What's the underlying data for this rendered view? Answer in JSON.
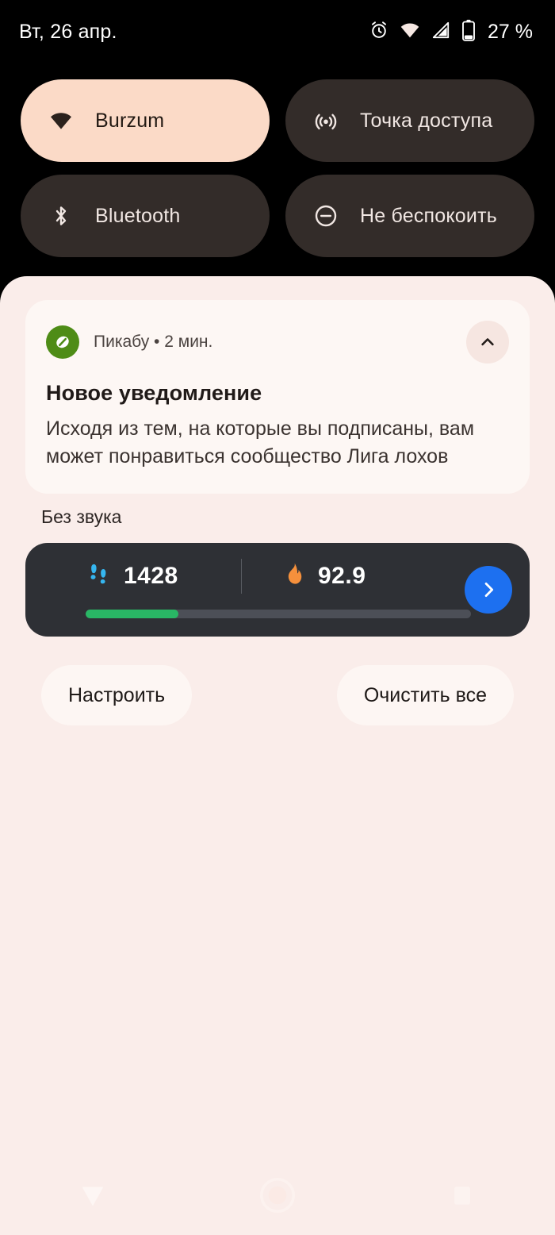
{
  "status_bar": {
    "date": "Вт, 26 апр.",
    "battery_percent": "27 %",
    "icons": [
      "alarm-icon",
      "wifi-icon",
      "cell-signal-icon",
      "battery-icon"
    ]
  },
  "quick_settings": {
    "tiles": [
      {
        "label": "Burzum",
        "icon": "wifi-icon",
        "state": "on"
      },
      {
        "label": "Точка доступа",
        "icon": "hotspot-icon",
        "state": "off"
      },
      {
        "label": "Bluetooth",
        "icon": "bluetooth-icon",
        "state": "off"
      },
      {
        "label": "Не беспокоить",
        "icon": "do-not-disturb-icon",
        "state": "off"
      }
    ]
  },
  "notification": {
    "app_name": "Пикабу",
    "separator": "•",
    "time": "2 мин.",
    "meta": "Пикабу • 2 мин.",
    "title": "Новое уведомление",
    "body": "Исходя из тем, на которые вы подписаны, вам может понравиться сообщество Лига лохов",
    "collapse_icon": "chevron-up-icon",
    "app_icon": "pikabu-logo-icon"
  },
  "silent_section": {
    "label": "Без звука"
  },
  "fitness_widget": {
    "steps_icon": "footsteps-icon",
    "steps_value": "1428",
    "calories_icon": "flame-icon",
    "calories_value": "92.9",
    "progress_percent": 24,
    "open_icon": "chevron-right-icon"
  },
  "actions": {
    "manage_label": "Настроить",
    "clear_all_label": "Очистить все"
  },
  "nav_bar": {
    "back": "back-triangle-icon",
    "home": "home-circle-icon",
    "recents": "recents-square-icon"
  },
  "colors": {
    "background": "#000000",
    "shade": "#FAEDEA",
    "tile_on": "#FBDAC7",
    "tile_off": "#332C29",
    "notification_card": "#FDF7F4",
    "fitness_card": "#2E3035",
    "progress_fill": "#29B765",
    "accent_blue": "#1D70F0",
    "steps_icon": "#35B6F0",
    "flame_icon": "#F5903C",
    "app_icon_green": "#4E8C16"
  }
}
